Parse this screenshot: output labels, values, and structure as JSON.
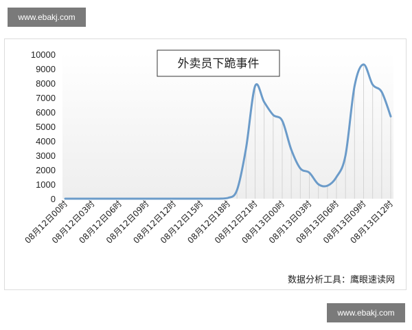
{
  "watermark": {
    "text": "www.ebakj.com"
  },
  "chart_data": {
    "type": "area",
    "title": "外卖员下跪事件",
    "source": "数据分析工具：鹰眼速读网",
    "xlabel": "",
    "ylabel": "",
    "ylim": [
      0,
      10000
    ],
    "yticks": [
      "10000",
      "9000",
      "8000",
      "7000",
      "6000",
      "5000",
      "4000",
      "3000",
      "2000",
      "1000",
      "0"
    ],
    "x_tick_labels": [
      "08月12日00时",
      "08月12日03时",
      "08月12日06时",
      "08月12日09时",
      "08月12日12时",
      "08月12日15时",
      "08月12日18时",
      "08月12日21时",
      "08月13日00时",
      "08月13日03时",
      "08月13日06时",
      "08月13日09时",
      "08月13日12时"
    ],
    "grid": false,
    "legend": "none",
    "line_color": "#6b9bc9",
    "series": [
      {
        "x": [
          "08月12日00时",
          "08月12日01时",
          "08月12日02时",
          "08月12日03时",
          "08月12日04时",
          "08月12日05时",
          "08月12日06时",
          "08月12日07时",
          "08月12日08时",
          "08月12日09时",
          "08月12日10时",
          "08月12日11时",
          "08月12日12时",
          "08月12日13时",
          "08月12日14时",
          "08月12日15时",
          "08月12日16时",
          "08月12日17时",
          "08月12日18时",
          "08月12日19时",
          "08月12日20时",
          "08月12日21时",
          "08月12日22时",
          "08月12日23时",
          "08月13日00时",
          "08月13日01时",
          "08月13日02时",
          "08月13日03时",
          "08月13日04时",
          "08月13日05时",
          "08月13日06时",
          "08月13日07时",
          "08月13日08时",
          "08月13日09时",
          "08月13日10时",
          "08月13日11时",
          "08月13日12时"
        ],
        "values": [
          0,
          0,
          0,
          0,
          0,
          0,
          0,
          0,
          0,
          0,
          0,
          0,
          0,
          0,
          0,
          0,
          0,
          0,
          50,
          600,
          3500,
          7800,
          6700,
          5800,
          5400,
          3400,
          2100,
          1800,
          1000,
          900,
          1500,
          3000,
          7800,
          9300,
          7900,
          7400,
          5700
        ]
      }
    ]
  }
}
